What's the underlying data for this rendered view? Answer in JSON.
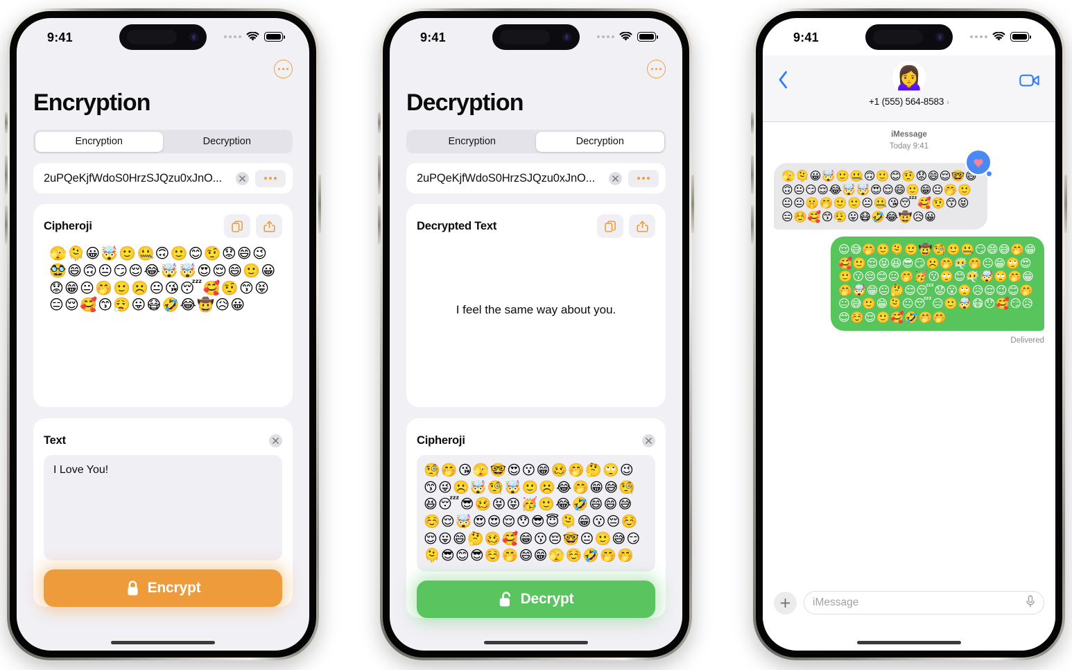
{
  "statusbar": {
    "time": "9:41",
    "cellular_icon": "cellular-dots-icon",
    "wifi_icon": "wifi-icon",
    "battery_icon": "battery-icon"
  },
  "phone1": {
    "title": "Encryption",
    "more_button_label": "more-options",
    "segmented": {
      "options": [
        "Encryption",
        "Decryption"
      ],
      "selected": "Encryption"
    },
    "keyfield": {
      "value": "2uPQeKjfWdoS0HrzSJQzu0xJnO...",
      "clear_label": "clear",
      "more_label": "key-options"
    },
    "cipher_card": {
      "title": "Cipheroji",
      "copy_label": "copy",
      "share_label": "share",
      "emoji": "🫣🫠😀🤯🙂🤐🙃🙂😊🤨😟😄😉🥸😄🙃😐😏😌😂🤯🤯😍😌😄🙂😀😟😁😐🤭🙂☹️😐😘😴🥰🤨😙😝😑😌🥰😙😮‍💨😛😷🤣😂🤠😥😀"
    },
    "text_card": {
      "title": "Text",
      "clear_label": "clear",
      "value": "I Love You!"
    },
    "action": {
      "label": "Encrypt",
      "icon": "lock-closed-icon",
      "color": "#EE9C3B"
    }
  },
  "phone2": {
    "title": "Decryption",
    "more_button_label": "more-options",
    "segmented": {
      "options": [
        "Encryption",
        "Decryption"
      ],
      "selected": "Decryption"
    },
    "keyfield": {
      "value": "2uPQeKjfWdoS0HrzSJQzu0xJnO...",
      "clear_label": "clear",
      "more_label": "key-options"
    },
    "decrypted_card": {
      "title": "Decrypted Text",
      "copy_label": "copy",
      "share_label": "share",
      "value": "I feel the same way about you."
    },
    "cipher_card": {
      "title": "Cipheroji",
      "clear_label": "clear",
      "emoji": "🧐🤭😘🫣🤓😍😗😁🥴🤭🤔🙄😉😙😜☹️🤯🧐🤯🙂☹️😂🤭😁😅🧐😆😴😎🥴😝😝🥳🙂😂🤣😄😄😅☺️😌🤯😍😍😌😯😎😇🫠😁😗😔☺️😌😛😄🤔🥴🥰😁😗😔🤓😐🙂😅😏🫠😎😊😎☺️🤭😄😁🫣☺️🤣🤭🤭"
    },
    "action": {
      "label": "Decrypt",
      "icon": "lock-open-icon",
      "color": "#5AC45F"
    }
  },
  "phone3": {
    "back_label": "back",
    "facetime_label": "facetime",
    "contact": {
      "name": "+1 (555) 564-8583",
      "avatar": "🙍‍♀️",
      "chevron": "›"
    },
    "thread_header": {
      "service": "iMessage",
      "date": "Today 9:41"
    },
    "messages": [
      {
        "direction": "in",
        "emoji": "🫣🫠😀🤯🙂🤐🙃🙂😊🤨😟😄😌🤓😄🙃😐😏😌😂🤯🤯😍😌😄🙂😁😐🤭🙂😐😐🤫🤭🙂🙂😐🤐😘😴🥰🤨😙😝😑☺️🥰😙😮‍💨😛😷🤣😂🤠😥😀",
        "tapback": "heart"
      },
      {
        "direction": "out",
        "emoji": "😌😅🤭🙂🫠🙂🤠🧐🙂🤐😏😄😅🤭😁🥰🙂😌😝😆😎😏☹️🤭😶‍🌫️🤭😐😁🙄😍🙂😗😔😊😐🤭🥳😗🙄😊😶‍🌫️🤯🙄🤭😁🤭🤯😁😐🤔😌😴😟😮🙄😥😌😉😊🤭😐😅🙂😁🫠😐😴😑🙂🤯😷😯🥰😏😥😊☺️😌🙂🥰🤣🤭🤭",
        "status": "Delivered"
      }
    ],
    "composer": {
      "plus_label": "add-attachment",
      "placeholder": "iMessage",
      "mic_label": "dictate"
    }
  }
}
